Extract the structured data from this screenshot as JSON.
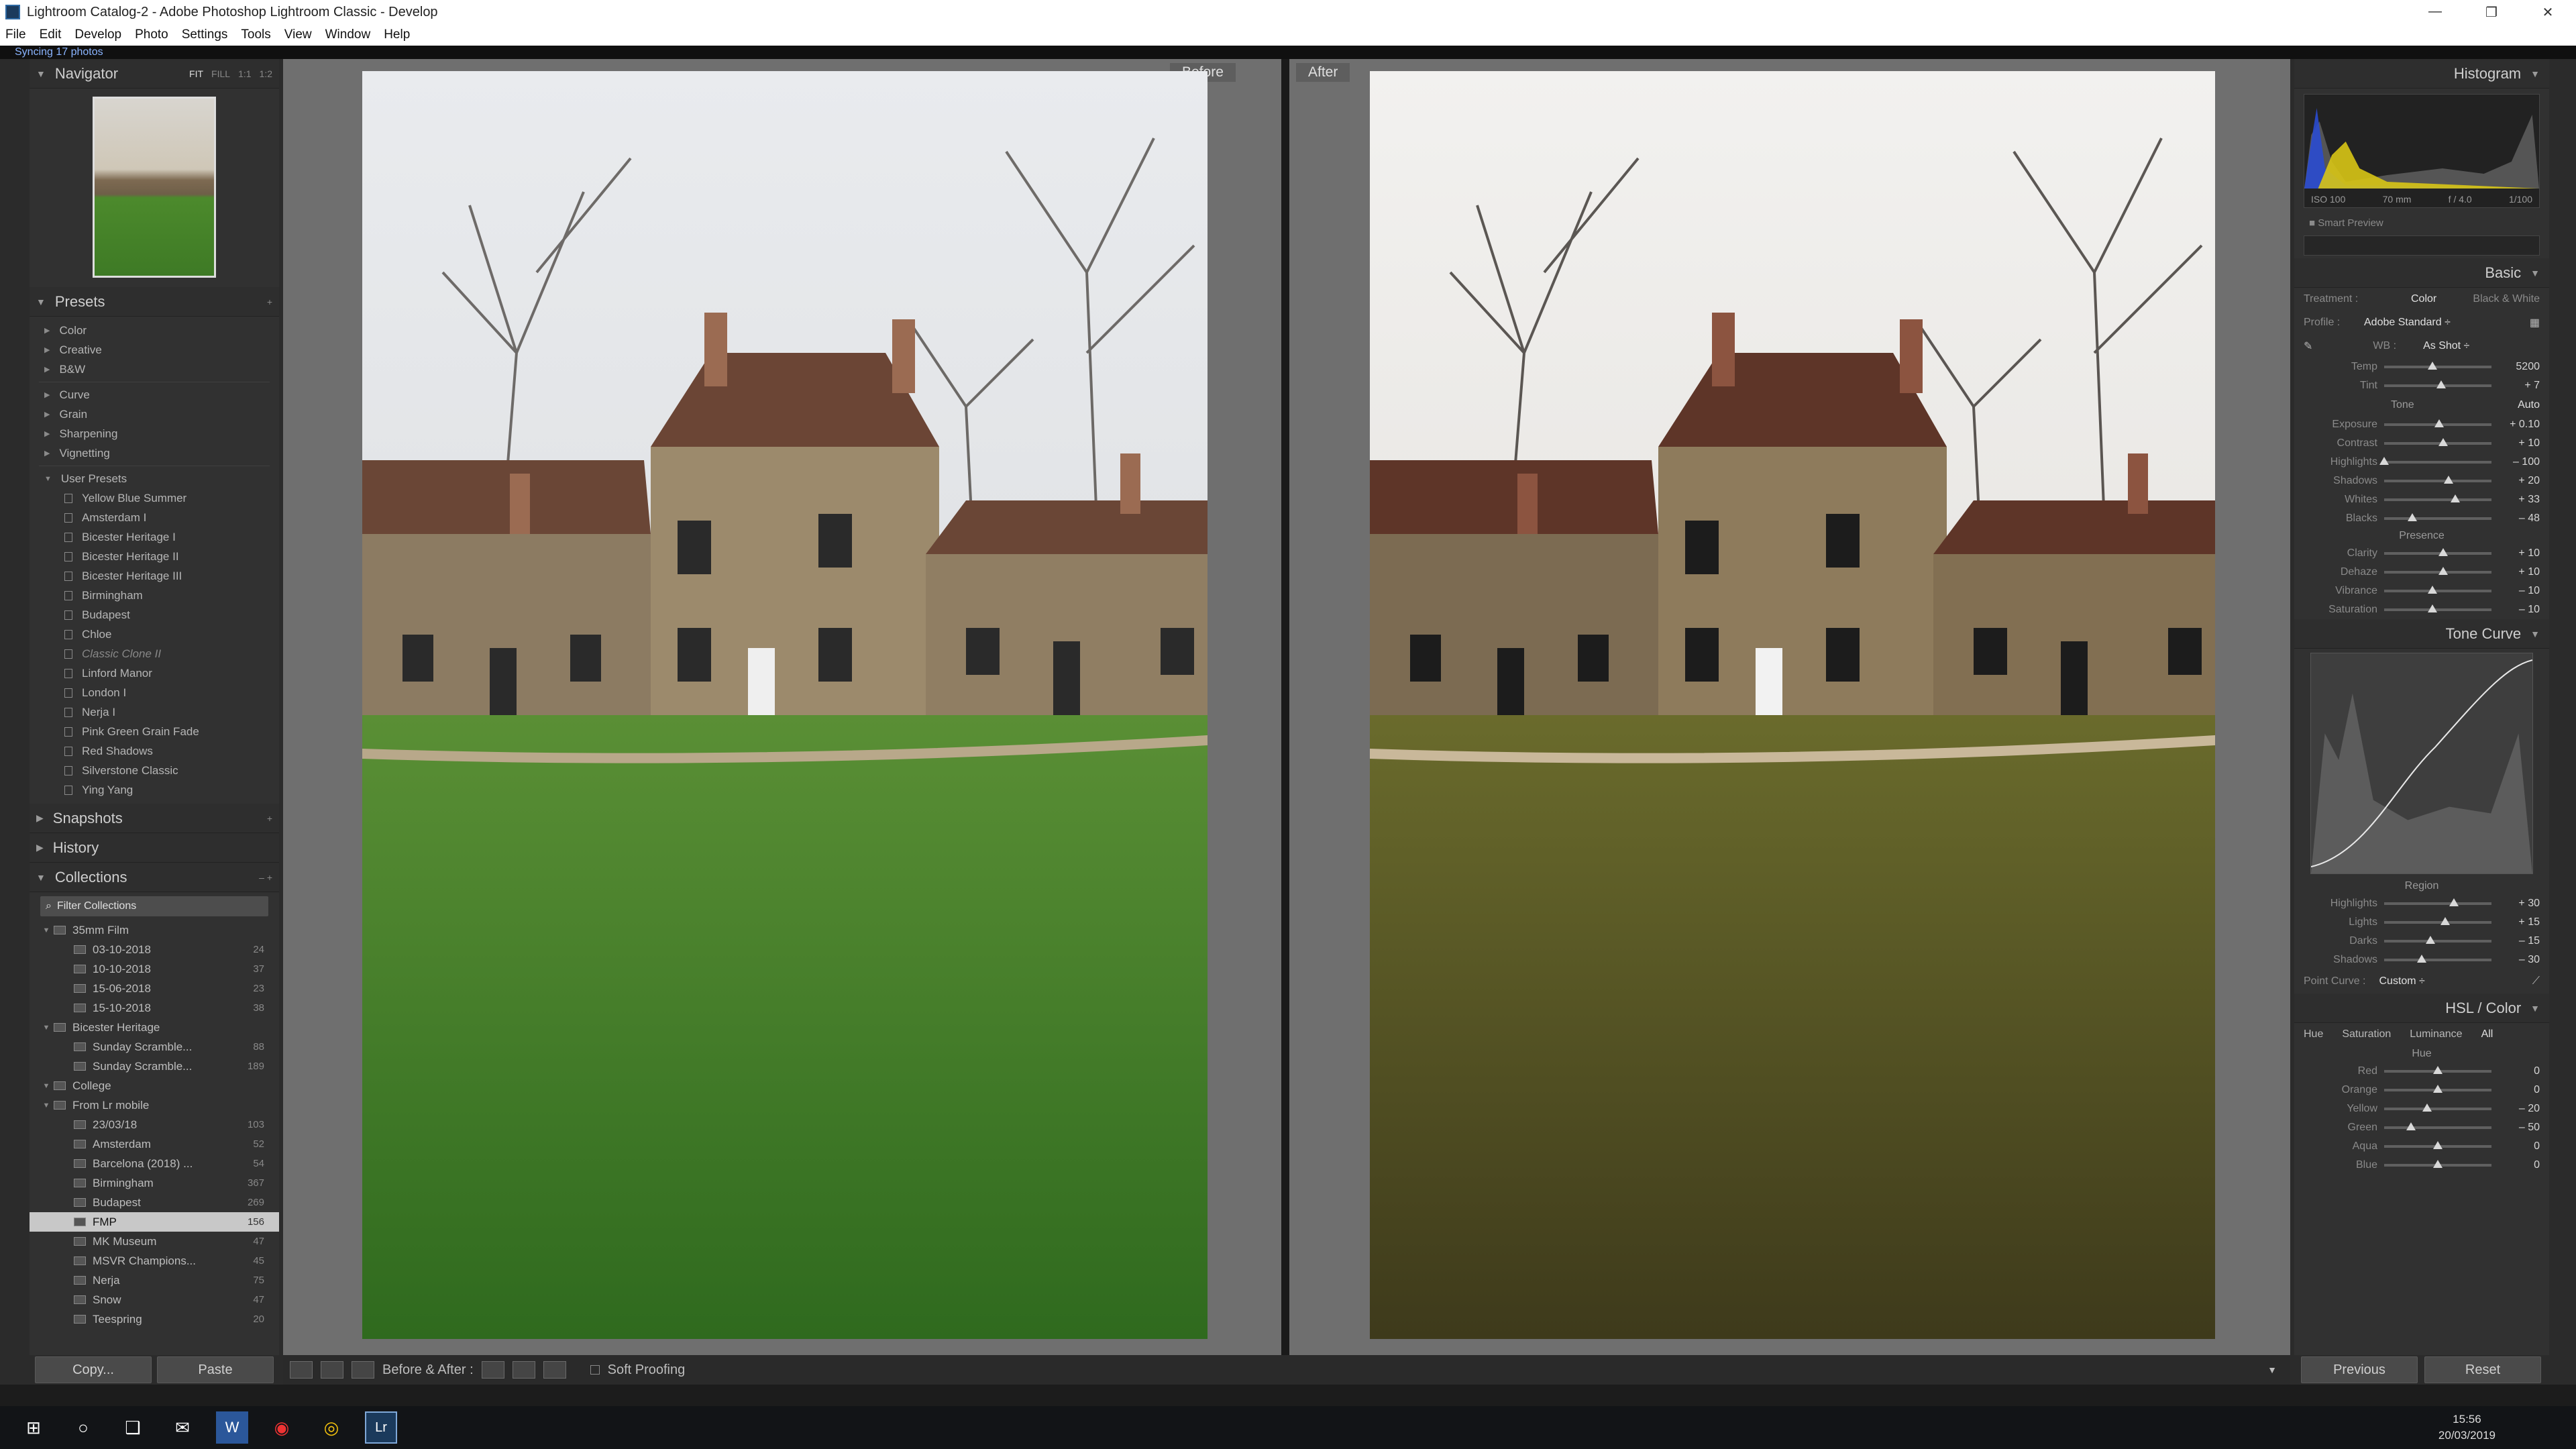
{
  "window": {
    "title": "Lightroom Catalog-2 - Adobe Photoshop Lightroom Classic - Develop",
    "controls": [
      "—",
      "❐",
      "✕"
    ]
  },
  "menu": [
    "File",
    "Edit",
    "Develop",
    "Photo",
    "Settings",
    "Tools",
    "View",
    "Window",
    "Help"
  ],
  "status": "Syncing 17 photos",
  "navigator": {
    "title": "Navigator",
    "modes": [
      "FIT",
      "FILL",
      "1:1",
      "1:2"
    ]
  },
  "presets": {
    "title": "Presets",
    "groups_a": [
      "Color",
      "Creative",
      "B&W"
    ],
    "groups_b": [
      "Curve",
      "Grain",
      "Sharpening",
      "Vignetting"
    ],
    "user": "User Presets",
    "user_items": [
      "Yellow Blue Summer",
      "Amsterdam I",
      "Bicester Heritage I",
      "Bicester Heritage II",
      "Bicester Heritage III",
      "Birmingham",
      "Budapest",
      "Chloe",
      "Classic Clone II",
      "Linford Manor",
      "London I",
      "Nerja I",
      "Pink Green Grain Fade",
      "Red Shadows",
      "Silverstone Classic",
      "Ying Yang"
    ]
  },
  "snapshots": "Snapshots",
  "history": "History",
  "collections": {
    "title": "Collections",
    "filter": "Filter Collections",
    "items": [
      {
        "lvl": 1,
        "name": "35mm Film",
        "cnt": "",
        "set": true
      },
      {
        "lvl": 2,
        "name": "03-10-2018",
        "cnt": "24"
      },
      {
        "lvl": 2,
        "name": "10-10-2018",
        "cnt": "37"
      },
      {
        "lvl": 2,
        "name": "15-06-2018",
        "cnt": "23"
      },
      {
        "lvl": 2,
        "name": "15-10-2018",
        "cnt": "38"
      },
      {
        "lvl": 1,
        "name": "Bicester Heritage",
        "cnt": "",
        "set": true
      },
      {
        "lvl": 2,
        "name": "Sunday Scramble...",
        "cnt": "88"
      },
      {
        "lvl": 2,
        "name": "Sunday Scramble...",
        "cnt": "189"
      },
      {
        "lvl": 1,
        "name": "College",
        "cnt": "",
        "set": true
      },
      {
        "lvl": 1,
        "name": "From Lr mobile",
        "cnt": "",
        "set": true
      },
      {
        "lvl": 2,
        "name": "23/03/18",
        "cnt": "103"
      },
      {
        "lvl": 2,
        "name": "Amsterdam",
        "cnt": "52"
      },
      {
        "lvl": 2,
        "name": "Barcelona (2018) ...",
        "cnt": "54"
      },
      {
        "lvl": 2,
        "name": "Birmingham",
        "cnt": "367"
      },
      {
        "lvl": 2,
        "name": "Budapest",
        "cnt": "269"
      },
      {
        "lvl": 2,
        "name": "FMP",
        "cnt": "156",
        "sel": true
      },
      {
        "lvl": 2,
        "name": "MK Museum",
        "cnt": "47"
      },
      {
        "lvl": 2,
        "name": "MSVR Champions...",
        "cnt": "45"
      },
      {
        "lvl": 2,
        "name": "Nerja",
        "cnt": "75"
      },
      {
        "lvl": 2,
        "name": "Snow",
        "cnt": "47"
      },
      {
        "lvl": 2,
        "name": "Teespring",
        "cnt": "20"
      }
    ]
  },
  "copy": "Copy...",
  "paste": "Paste",
  "view": {
    "before": "Before",
    "after": "After"
  },
  "toolbar": {
    "ba": "Before & After :",
    "soft": "Soft Proofing"
  },
  "histogram": {
    "title": "Histogram",
    "iso": "ISO 100",
    "focal": "70 mm",
    "aperture": "f / 4.0",
    "shutter": "1/100",
    "smart": "Smart Preview"
  },
  "basic": {
    "title": "Basic",
    "treatment": "Treatment :",
    "color": "Color",
    "bw": "Black & White",
    "profile": "Profile :",
    "profile_val": "Adobe Standard ÷",
    "wb": "WB :",
    "wb_val": "As Shot ÷",
    "temp": {
      "l": "Temp",
      "v": "5200",
      "p": 0.45
    },
    "tint": {
      "l": "Tint",
      "v": "+ 7",
      "p": 0.53
    },
    "tone": "Tone",
    "auto": "Auto",
    "exposure": {
      "l": "Exposure",
      "v": "+ 0.10",
      "p": 0.51
    },
    "contrast": {
      "l": "Contrast",
      "v": "+ 10",
      "p": 0.55
    },
    "highlights": {
      "l": "Highlights",
      "v": "– 100",
      "p": 0.0
    },
    "shadows": {
      "l": "Shadows",
      "v": "+ 20",
      "p": 0.6
    },
    "whites": {
      "l": "Whites",
      "v": "+ 33",
      "p": 0.66
    },
    "blacks": {
      "l": "Blacks",
      "v": "– 48",
      "p": 0.26
    },
    "presence": "Presence",
    "clarity": {
      "l": "Clarity",
      "v": "+ 10",
      "p": 0.55
    },
    "dehaze": {
      "l": "Dehaze",
      "v": "+ 10",
      "p": 0.55
    },
    "vibrance": {
      "l": "Vibrance",
      "v": "– 10",
      "p": 0.45
    },
    "saturation": {
      "l": "Saturation",
      "v": "– 10",
      "p": 0.45
    }
  },
  "tonecurve": {
    "title": "Tone Curve",
    "region": "Region",
    "highlights": {
      "l": "Highlights",
      "v": "+ 30",
      "p": 0.65
    },
    "lights": {
      "l": "Lights",
      "v": "+ 15",
      "p": 0.57
    },
    "darks": {
      "l": "Darks",
      "v": "– 15",
      "p": 0.43
    },
    "shadows": {
      "l": "Shadows",
      "v": "– 30",
      "p": 0.35
    },
    "point": "Point Curve :",
    "point_val": "Custom ÷"
  },
  "hsl": {
    "title": "HSL / Color",
    "tabs": [
      "Hue",
      "Saturation",
      "Luminance",
      "All"
    ],
    "hue": "Hue",
    "red": {
      "l": "Red",
      "v": "0",
      "p": 0.5
    },
    "orange": {
      "l": "Orange",
      "v": "0",
      "p": 0.5
    },
    "yellow": {
      "l": "Yellow",
      "v": "– 20",
      "p": 0.4
    },
    "green": {
      "l": "Green",
      "v": "– 50",
      "p": 0.25
    },
    "aqua": {
      "l": "Aqua",
      "v": "0",
      "p": 0.5
    },
    "blue": {
      "l": "Blue",
      "v": "0",
      "p": 0.5
    }
  },
  "previous": "Previous",
  "reset": "Reset",
  "clock": {
    "time": "15:56",
    "date": "20/03/2019"
  }
}
